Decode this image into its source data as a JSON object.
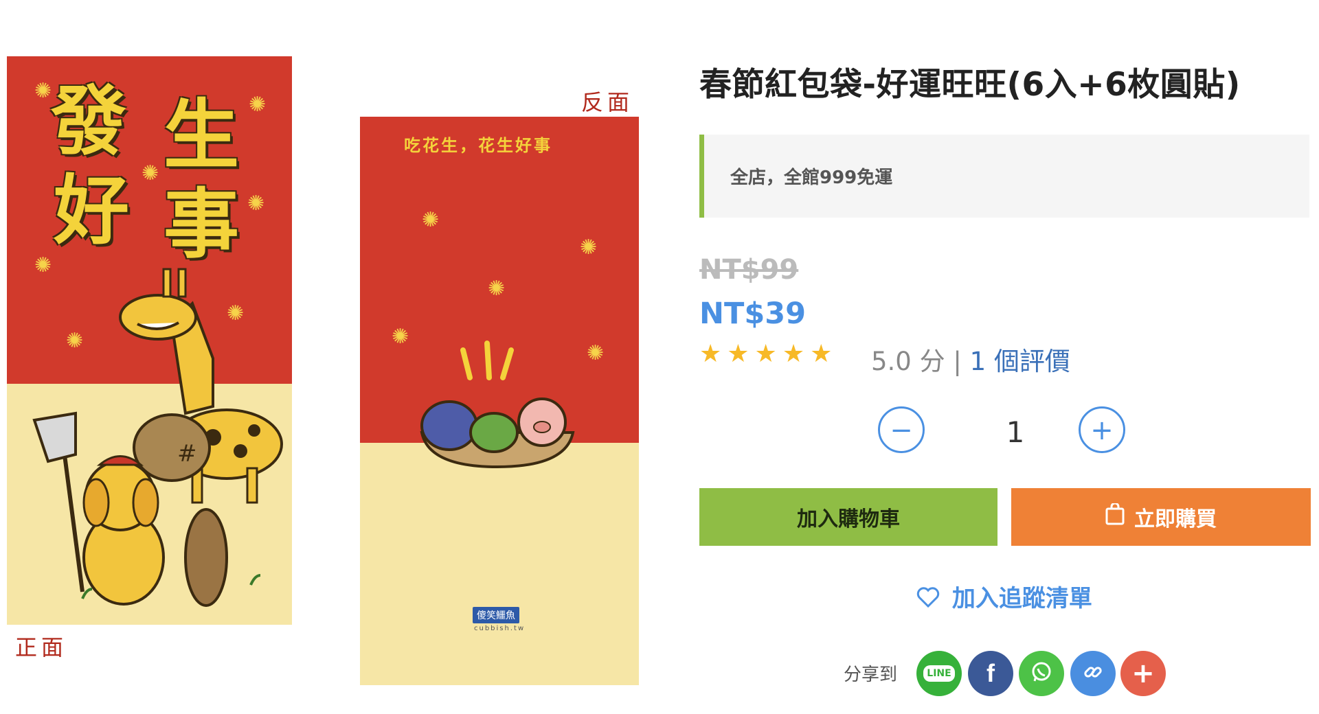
{
  "gallery": {
    "front": {
      "label": "正面",
      "chars": [
        "發",
        "生",
        "好",
        "事"
      ]
    },
    "back": {
      "label": "反面",
      "slogan": "吃花生，花生好事",
      "brand": "傻笑鱷魚",
      "brand_sub": "cubbish.tw"
    }
  },
  "product": {
    "title": "春節紅包袋-好運旺旺(6入+6枚圓貼)",
    "promo": "全店，全館999免運",
    "original_price": "NT$99",
    "sale_price": "NT$39",
    "rating": {
      "stars": "★★★★★",
      "score_text": "5.0 分",
      "separator": "|",
      "count_text": "1 個評價"
    },
    "quantity": {
      "minus": "−",
      "value": "1",
      "plus": "+"
    },
    "add_to_cart": "加入購物車",
    "buy_now": "立即購買",
    "wishlist": "加入追蹤清單",
    "share": {
      "label": "分享到",
      "line": "LINE",
      "facebook": "f",
      "more": "+"
    }
  },
  "colors": {
    "accent": "#4a90e2",
    "cart": "#8fbd45",
    "buy": "#ef8136",
    "envelope_red": "#d13a2c",
    "envelope_cream": "#f6e6a6"
  }
}
